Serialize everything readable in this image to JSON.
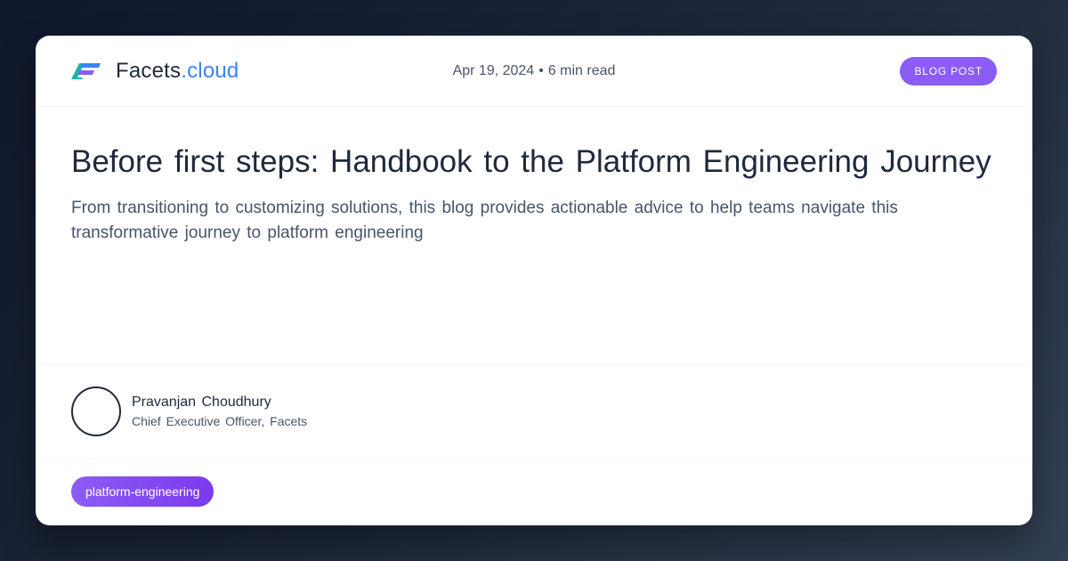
{
  "brand": {
    "name": "Facets",
    "tld": ".cloud",
    "logo_icon": "facets-logo-icon",
    "colors": {
      "accent": "#3b82f6",
      "logo_teal": "#14b8a6",
      "logo_blue": "#3b82f6",
      "logo_purple": "#8b5cf6"
    }
  },
  "meta": {
    "date": "Apr 19, 2024",
    "separator": "•",
    "read_time": "6 min read"
  },
  "badge": {
    "label": "BLOG POST",
    "color": "#8b5cf6"
  },
  "article": {
    "title": "Before first steps: Handbook to the Platform Engineering Journey",
    "subtitle": "From transitioning to customizing solutions, this blog provides actionable advice to help teams navigate this transformative journey to platform engineering"
  },
  "author": {
    "name": "Pravanjan Choudhury",
    "role": "Chief Executive Officer, Facets"
  },
  "tags": [
    {
      "label": "platform-engineering",
      "color": "#8b5cf6"
    }
  ]
}
